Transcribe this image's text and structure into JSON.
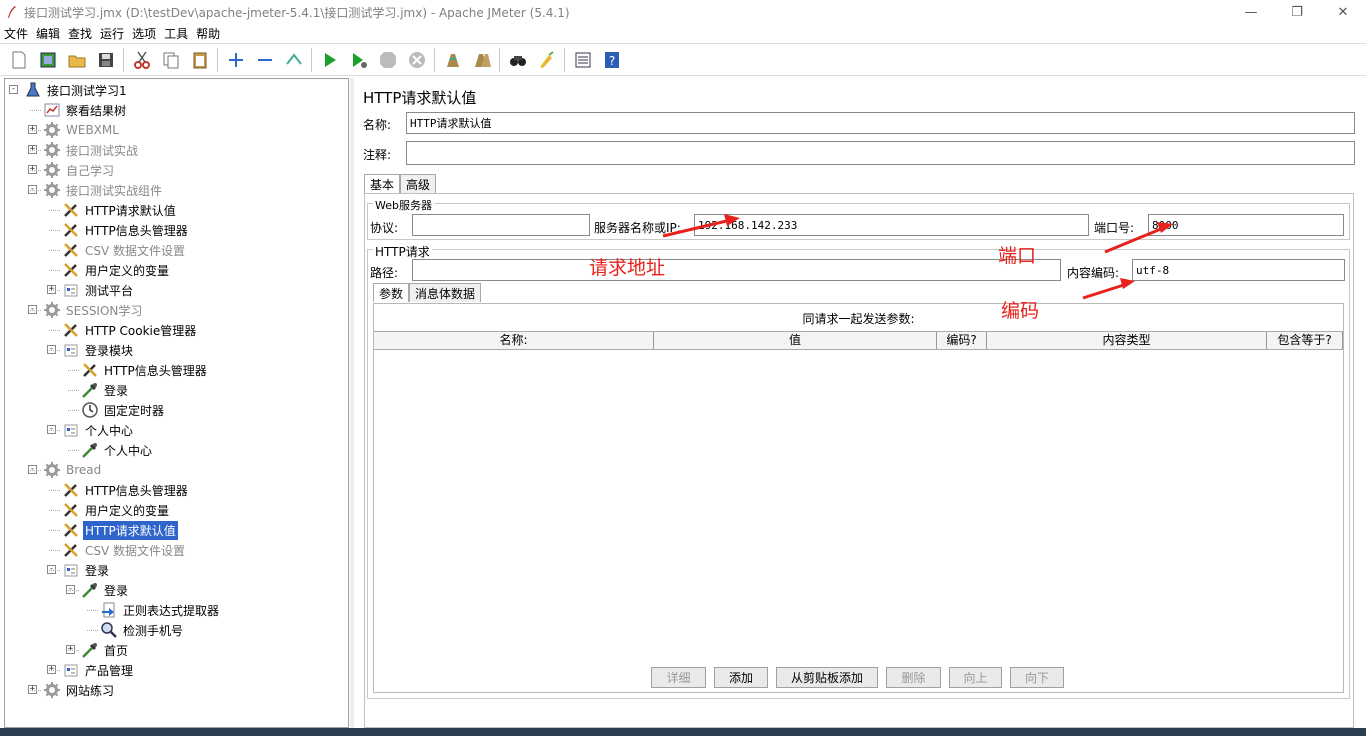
{
  "window": {
    "title": "接口测试学习.jmx (D:\\testDev\\apache-jmeter-5.4.1\\接口测试学习.jmx) - Apache JMeter (5.4.1)",
    "minimize": "—",
    "restore": "❐",
    "close": "✕"
  },
  "menu": [
    "文件",
    "编辑",
    "查找",
    "运行",
    "选项",
    "工具",
    "帮助"
  ],
  "tree": [
    {
      "label": "接口测试学习1",
      "icon": "flask-icon",
      "level": 0,
      "toggle": "-",
      "disabled": false
    },
    {
      "label": "察看结果树",
      "icon": "chart-icon",
      "level": 1,
      "toggle": "",
      "disabled": false
    },
    {
      "label": "WEBXML",
      "icon": "gear-icon",
      "level": 1,
      "toggle": "+",
      "disabled": true
    },
    {
      "label": "接口测试实战",
      "icon": "gear-icon",
      "level": 1,
      "toggle": "+",
      "disabled": true
    },
    {
      "label": "自己学习",
      "icon": "gear-icon",
      "level": 1,
      "toggle": "+",
      "disabled": true
    },
    {
      "label": "接口测试实战组件",
      "icon": "gear-icon",
      "level": 1,
      "toggle": "-",
      "disabled": true
    },
    {
      "label": "HTTP请求默认值",
      "icon": "wrench-icon",
      "level": 2,
      "toggle": "",
      "disabled": false
    },
    {
      "label": "HTTP信息头管理器",
      "icon": "wrench-icon",
      "level": 2,
      "toggle": "",
      "disabled": false
    },
    {
      "label": "CSV 数据文件设置",
      "icon": "wrench-icon",
      "level": 2,
      "toggle": "",
      "disabled": true
    },
    {
      "label": "用户定义的变量",
      "icon": "wrench-icon",
      "level": 2,
      "toggle": "",
      "disabled": false
    },
    {
      "label": "测试平台",
      "icon": "controller-icon",
      "level": 2,
      "toggle": "+",
      "disabled": false
    },
    {
      "label": "SESSION学习",
      "icon": "gear-icon",
      "level": 1,
      "toggle": "-",
      "disabled": true
    },
    {
      "label": "HTTP Cookie管理器",
      "icon": "wrench-icon",
      "level": 2,
      "toggle": "",
      "disabled": false
    },
    {
      "label": "登录模块",
      "icon": "controller-icon",
      "level": 2,
      "toggle": "-",
      "disabled": false
    },
    {
      "label": "HTTP信息头管理器",
      "icon": "wrench-icon",
      "level": 3,
      "toggle": "",
      "disabled": false
    },
    {
      "label": "登录",
      "icon": "pipette-icon",
      "level": 3,
      "toggle": "",
      "disabled": false
    },
    {
      "label": "固定定时器",
      "icon": "timer-icon",
      "level": 3,
      "toggle": "",
      "disabled": false
    },
    {
      "label": "个人中心",
      "icon": "controller-icon",
      "level": 2,
      "toggle": "-",
      "disabled": false
    },
    {
      "label": "个人中心",
      "icon": "pipette-icon",
      "level": 3,
      "toggle": "",
      "disabled": false
    },
    {
      "label": "Bread",
      "icon": "gear-icon",
      "level": 1,
      "toggle": "-",
      "disabled": true
    },
    {
      "label": "HTTP信息头管理器",
      "icon": "wrench-icon",
      "level": 2,
      "toggle": "",
      "disabled": false
    },
    {
      "label": "用户定义的变量",
      "icon": "wrench-icon",
      "level": 2,
      "toggle": "",
      "disabled": false
    },
    {
      "label": "HTTP请求默认值",
      "icon": "wrench-icon",
      "level": 2,
      "toggle": "",
      "disabled": false,
      "selected": true
    },
    {
      "label": "CSV 数据文件设置",
      "icon": "wrench-icon",
      "level": 2,
      "toggle": "",
      "disabled": true
    },
    {
      "label": "登录",
      "icon": "controller-icon",
      "level": 2,
      "toggle": "-",
      "disabled": false
    },
    {
      "label": "登录",
      "icon": "pipette-icon",
      "level": 3,
      "toggle": "-",
      "disabled": false
    },
    {
      "label": "正则表达式提取器",
      "icon": "extractor-icon",
      "level": 4,
      "toggle": "",
      "disabled": false
    },
    {
      "label": "检测手机号",
      "icon": "magnifier-icon",
      "level": 4,
      "toggle": "",
      "disabled": false
    },
    {
      "label": "首页",
      "icon": "pipette-icon",
      "level": 3,
      "toggle": "+",
      "disabled": false
    },
    {
      "label": "产品管理",
      "icon": "controller-icon",
      "level": 2,
      "toggle": "+",
      "disabled": false
    },
    {
      "label": "网站练习",
      "icon": "gear-icon",
      "level": 1,
      "toggle": "+",
      "disabled": false
    }
  ],
  "panel": {
    "title": "HTTP请求默认值",
    "name_label": "名称:",
    "name_value": "HTTP请求默认值",
    "comment_label": "注释:",
    "comment_value": "",
    "tabs": [
      "基本",
      "高级"
    ],
    "web_server_title": "Web服务器",
    "protocol_label": "协议:",
    "protocol_value": "",
    "server_label": "服务器名称或IP:",
    "server_value": "192.168.142.233",
    "port_label": "端口号:",
    "port_value": "8000",
    "http_request_title": "HTTP请求",
    "path_label": "路径:",
    "path_value": "",
    "encoding_label": "内容编码:",
    "encoding_value": "utf-8",
    "sub_tabs": [
      "参数",
      "消息体数据"
    ],
    "table_caption": "同请求一起发送参数:",
    "columns": [
      "名称:",
      "值",
      "编码?",
      "内容类型",
      "包含等于?"
    ],
    "buttons": [
      {
        "label": "详细",
        "disabled": true
      },
      {
        "label": "添加",
        "disabled": false
      },
      {
        "label": "从剪贴板添加",
        "disabled": false
      },
      {
        "label": "删除",
        "disabled": true
      },
      {
        "label": "向上",
        "disabled": true
      },
      {
        "label": "向下",
        "disabled": true
      }
    ]
  },
  "annotations": {
    "request_address": "请求地址",
    "port": "端口",
    "encoding": "编码",
    "color": "#e8211c"
  }
}
